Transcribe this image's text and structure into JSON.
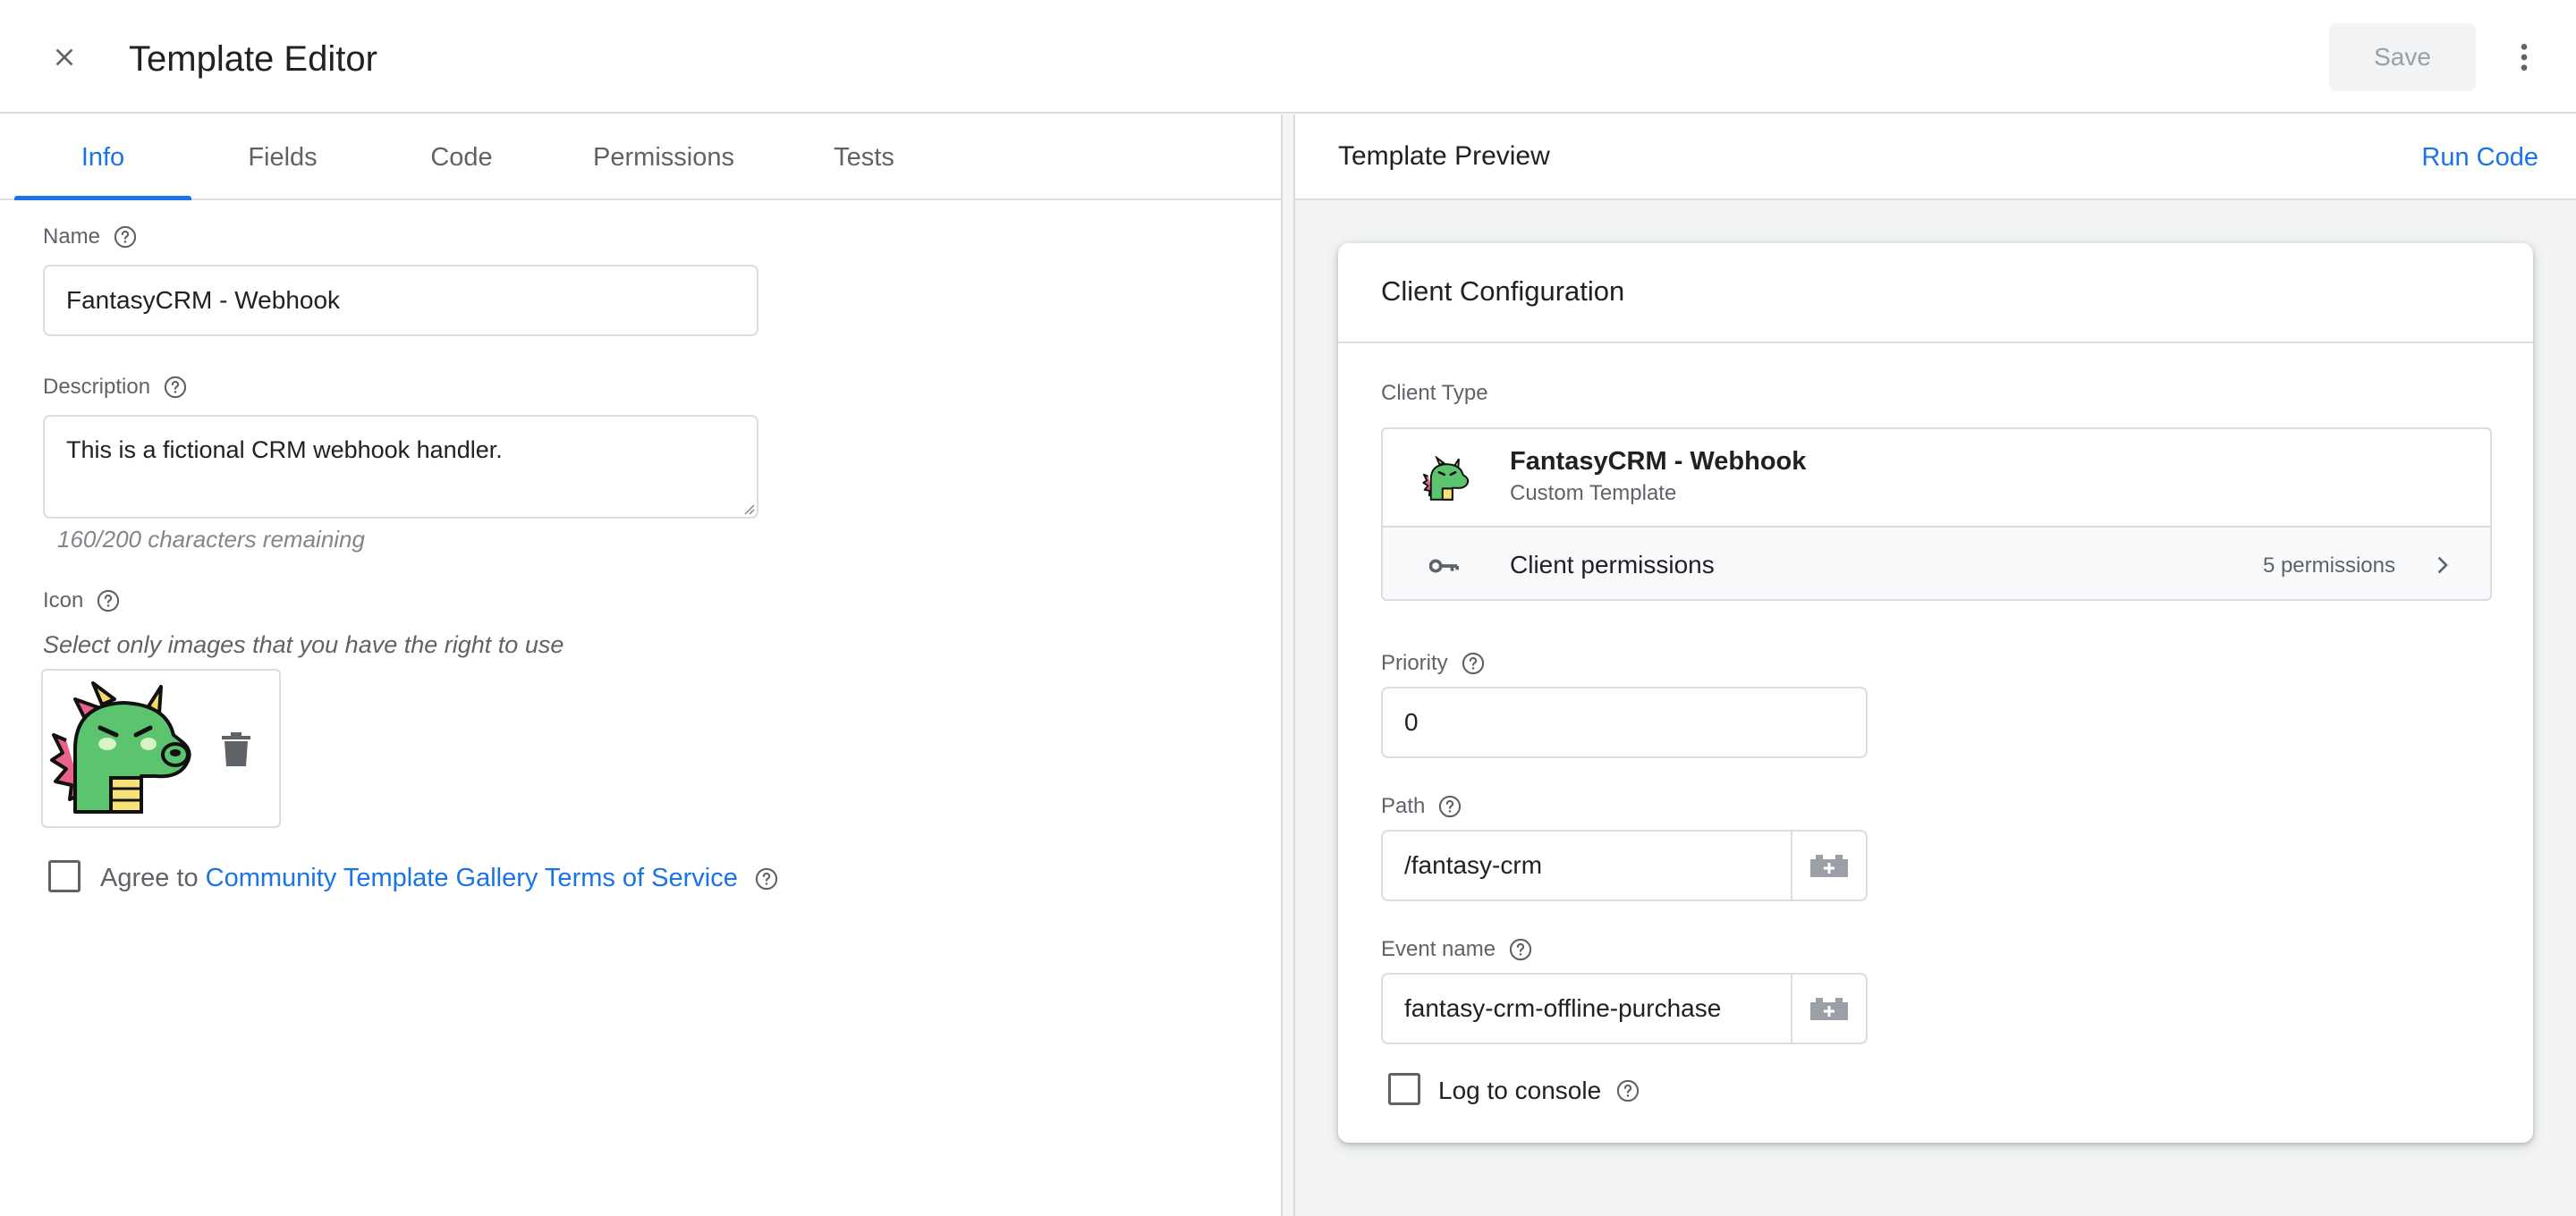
{
  "header": {
    "title": "Template Editor",
    "save_label": "Save"
  },
  "tabs": [
    {
      "label": "Info",
      "active": true
    },
    {
      "label": "Fields",
      "active": false
    },
    {
      "label": "Code",
      "active": false
    },
    {
      "label": "Permissions",
      "active": false
    },
    {
      "label": "Tests",
      "active": false
    }
  ],
  "info": {
    "name_label": "Name",
    "name_value": "FantasyCRM - Webhook",
    "description_label": "Description",
    "description_value": "This is a fictional CRM webhook handler.",
    "char_remaining": "160/200 characters remaining",
    "icon_label": "Icon",
    "icon_hint": "Select only images that you have the right to use",
    "agree_prefix": "Agree to",
    "agree_link": "Community Template Gallery Terms of Service",
    "agree_checked": false
  },
  "preview": {
    "title": "Template Preview",
    "run_code_label": "Run Code",
    "card_title": "Client Configuration",
    "client_type_label": "Client Type",
    "client_name": "FantasyCRM - Webhook",
    "client_subtitle": "Custom Template",
    "permissions_label": "Client permissions",
    "permissions_count": "5 permissions",
    "priority_label": "Priority",
    "priority_value": "0",
    "path_label": "Path",
    "path_value": "/fantasy-crm",
    "event_label": "Event name",
    "event_value": "fantasy-crm-offline-purchase",
    "log_label": "Log to console",
    "log_checked": false
  },
  "colors": {
    "accent": "#1a73e8",
    "text": "#202124",
    "muted": "#5f6368",
    "border": "#dadce0"
  },
  "icons": [
    "close-icon",
    "more-vert-icon",
    "help-icon",
    "trash-icon",
    "dragon-icon",
    "key-icon",
    "chevron-right-icon",
    "variable-picker-icon"
  ]
}
